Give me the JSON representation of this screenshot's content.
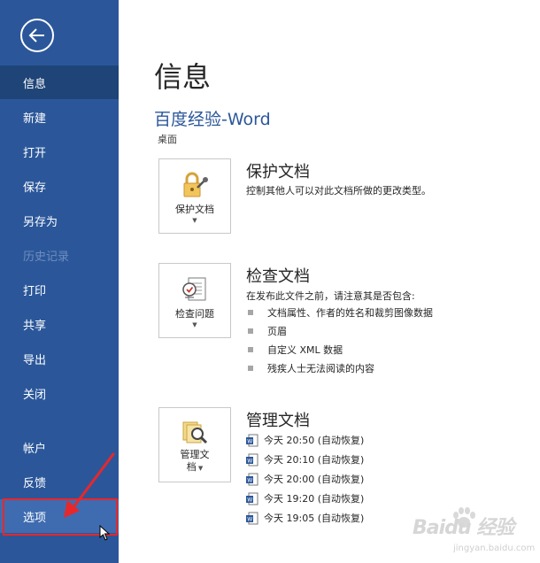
{
  "sidebar": {
    "items": [
      {
        "label": "信息",
        "state": "active"
      },
      {
        "label": "新建",
        "state": "normal"
      },
      {
        "label": "打开",
        "state": "normal"
      },
      {
        "label": "保存",
        "state": "normal"
      },
      {
        "label": "另存为",
        "state": "normal"
      },
      {
        "label": "历史记录",
        "state": "disabled"
      },
      {
        "label": "打印",
        "state": "normal"
      },
      {
        "label": "共享",
        "state": "normal"
      },
      {
        "label": "导出",
        "state": "normal"
      },
      {
        "label": "关闭",
        "state": "normal"
      },
      {
        "label": "帐户",
        "state": "normal"
      },
      {
        "label": "反馈",
        "state": "normal"
      },
      {
        "label": "选项",
        "state": "hover"
      }
    ],
    "back_icon": "back-arrow-icon"
  },
  "main": {
    "page_title": "信息",
    "doc_title": "百度经验-Word",
    "doc_path": "桌面",
    "protect": {
      "tile_label": "保护文档",
      "title": "保护文档",
      "desc": "控制其他人可以对此文档所做的更改类型。"
    },
    "inspect": {
      "tile_label": "检查问题",
      "title": "检查文档",
      "desc": "在发布此文件之前，请注意其是否包含:",
      "bullets": [
        "文档属性、作者的姓名和裁剪图像数据",
        "页眉",
        "自定义 XML 数据",
        "残疾人士无法阅读的内容"
      ]
    },
    "manage": {
      "tile_label_line1": "管理文",
      "tile_label_line2": "档",
      "title": "管理文档",
      "versions": [
        "今天 20:50 (自动恢复)",
        "今天 20:10 (自动恢复)",
        "今天 20:00 (自动恢复)",
        "今天 19:20 (自动恢复)",
        "今天 19:05 (自动恢复)"
      ]
    }
  },
  "watermark": {
    "main": "Baidu 经验",
    "sub": "jingyan.baidu.com"
  },
  "colors": {
    "sidebar": "#2b579a",
    "active": "#1f4477",
    "accent": "#2b579a",
    "highlight": "#e8272b"
  }
}
